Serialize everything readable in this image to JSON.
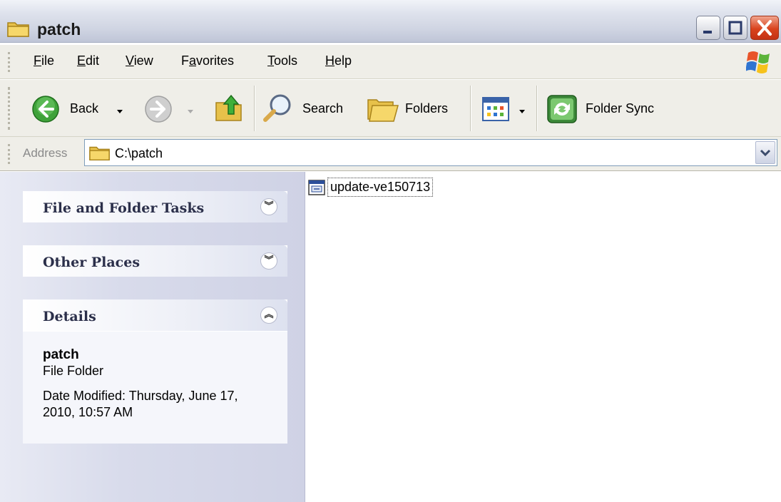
{
  "window": {
    "title": "patch"
  },
  "menu": {
    "items": [
      {
        "label": "File",
        "underline": "F",
        "rest": "ile"
      },
      {
        "label": "Edit",
        "underline": "E",
        "rest": "dit"
      },
      {
        "label": "View",
        "underline": "V",
        "rest": "iew"
      },
      {
        "label": "Favorites",
        "underline": "a",
        "pre": "F",
        "rest": "vorites"
      },
      {
        "label": "Tools",
        "underline": "T",
        "rest": "ools"
      },
      {
        "label": "Help",
        "underline": "H",
        "rest": "elp"
      }
    ]
  },
  "toolbar": {
    "back_label": "Back",
    "search_label": "Search",
    "folders_label": "Folders",
    "foldersync_label": "Folder Sync"
  },
  "address": {
    "label": "Address",
    "value": "C:\\patch"
  },
  "taskpane": {
    "file_folder_tasks": "File and Folder Tasks",
    "other_places": "Other Places",
    "details": {
      "title": "Details",
      "name": "patch",
      "type": "File Folder",
      "date_modified": "Date Modified: Thursday, June 17, 2010, 10:57 AM"
    }
  },
  "content": {
    "files": [
      {
        "name": "update-ve150713",
        "icon": "executable-file-icon"
      }
    ]
  },
  "colors": {
    "title_bar": "#cfd4e2",
    "close_button": "#d9431d",
    "task_pane": "#d8dbeb",
    "toolbar": "#efeee8"
  }
}
